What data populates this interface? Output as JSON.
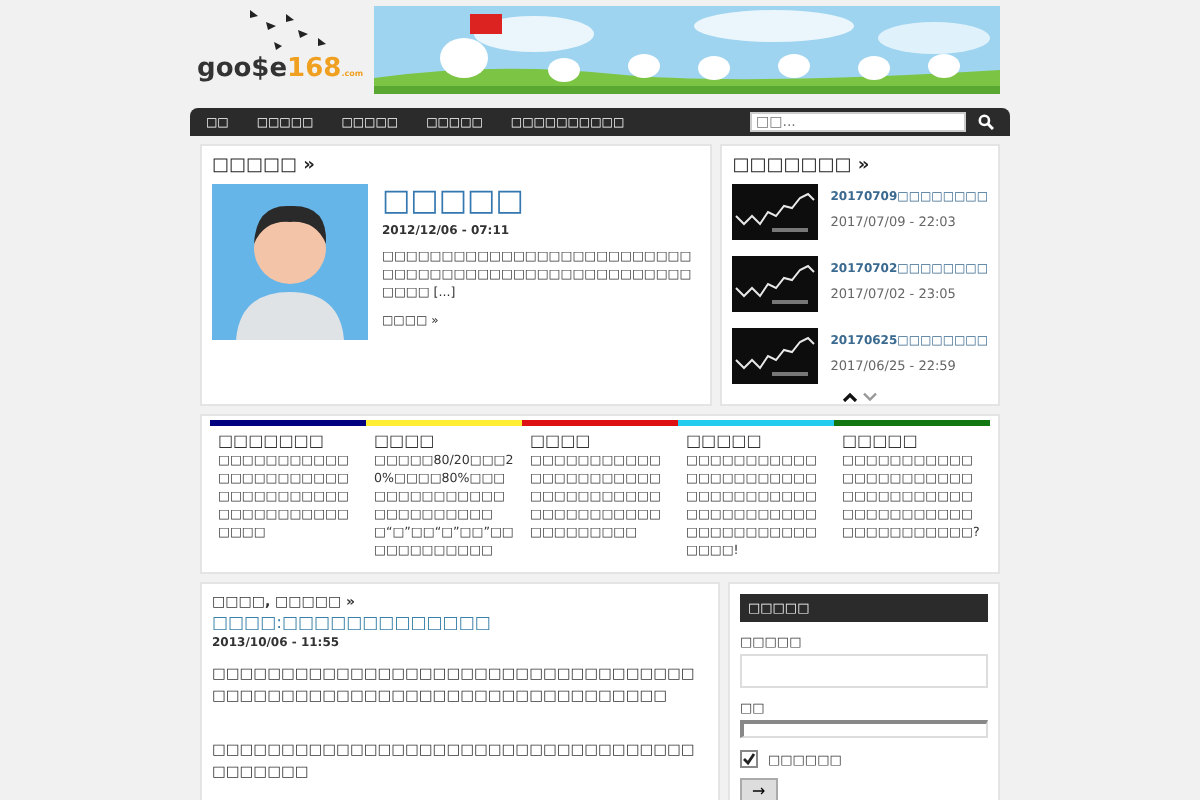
{
  "logo": {
    "text_main": "goo$e",
    "text_accent": "168",
    "suffix": ".com"
  },
  "nav": {
    "items": [
      {
        "label": "□□"
      },
      {
        "label": "□□□□□"
      },
      {
        "label": "□□□□□"
      },
      {
        "label": "□□□□□"
      },
      {
        "label": "□□□□□□□□□□"
      }
    ],
    "search": {
      "placeholder": "□□..."
    }
  },
  "featured": {
    "heading": "□□□□□ »",
    "title": "□□□□□",
    "date": "2012/12/06 - 07:11",
    "excerpt": "□□□□□□□□□□□□□□□□□□□□□□□□□□□□□□□□□□□□□□□□□□□□□□□□□□□□□□□□ [...]",
    "more": "□□□□ »"
  },
  "recent": {
    "heading": "□□□□□□□ »",
    "posts": [
      {
        "title": "20170709□□□□□□□□",
        "date": "2017/07/09 - 22:03"
      },
      {
        "title": "20170702□□□□□□□□",
        "date": "2017/07/02 - 23:05"
      },
      {
        "title": "20170625□□□□□□□□",
        "date": "2017/06/25 - 22:59"
      }
    ]
  },
  "columns": [
    {
      "color": "#000080",
      "title": "□□□□□□□",
      "text": "□□□□□□□□□□□□□□□□□□□□□□□□□□□□□□□□□□□□□□□□□□□□□□□□"
    },
    {
      "color": "#ffee33",
      "title": "□□□□",
      "text": "□□□□□80/20□□□20%□□□□80%□□□□□□□□□□□□□□□□□□□□□□□□□“□”□□“□”□□”□□□□□□□□□□□□"
    },
    {
      "color": "#dd1111",
      "title": "□□□□",
      "text": "□□□□□□□□□□□□□□□□□□□□□□□□□□□□□□□□□□□□□□□□□□□□□□□□□□□□□"
    },
    {
      "color": "#22ccee",
      "title": "□□□□□",
      "text": "□□□□□□□□□□□□□□□□□□□□□□□□□□□□□□□□□□□□□□□□□□□□□□□□□□□□□□□□□□□!"
    },
    {
      "color": "#117711",
      "title": "□□□□□",
      "text": "□□□□□□□□□□□□□□□□□□□□□□□□□□□□□□□□□□□□□□□□□□□□□□□□□□□□□□□?"
    }
  ],
  "article": {
    "category": "□□□□, □□□□□ »",
    "title": "□□□□:□□□□□□□□□□□□□",
    "date": "2013/10/06 - 11:55",
    "paragraphs": [
      "□□□□□□□□□□□□□□□□□□□□□□□□□□□□□□□□□□□□□□□□□□□□□□□□□□□□□□□□□□□□□□□□□□□□",
      "□□□□□□□□□□□□□□□□□□□□□□□□□□□□□□□□□□□□□□□□□□"
    ]
  },
  "login": {
    "heading": "□□□□□",
    "user_label": "□□□□□",
    "pass_label": "□□",
    "remember": {
      "label": "□□□□□□",
      "checked": true
    },
    "submit": "→"
  }
}
